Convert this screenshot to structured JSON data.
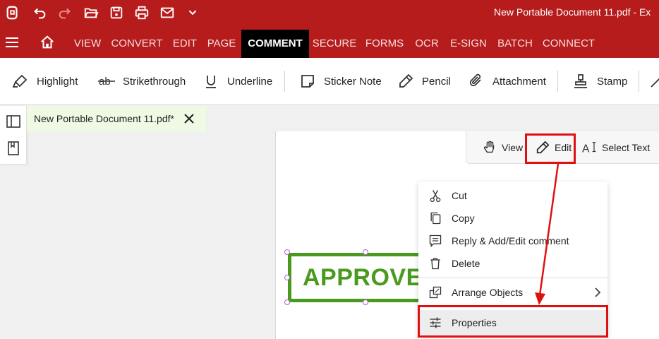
{
  "titlebar": {
    "document_title": "New Portable Document 11.pdf   -   Ex",
    "quick_access": [
      "app-logo-icon",
      "undo-icon",
      "redo-icon",
      "open-folder-icon",
      "save-icon",
      "print-icon",
      "email-icon",
      "chevron-down-icon"
    ]
  },
  "menu": {
    "tabs": [
      "VIEW",
      "CONVERT",
      "EDIT",
      "PAGE",
      "COMMENT",
      "SECURE",
      "FORMS",
      "OCR",
      "E-SIGN",
      "BATCH",
      "CONNECT"
    ],
    "active_tab": "COMMENT"
  },
  "ribbon": {
    "highlight": "Highlight",
    "strikethrough": "Strikethrough",
    "underline": "Underline",
    "sticker_note": "Sticker Note",
    "pencil": "Pencil",
    "attachment": "Attachment",
    "stamp": "Stamp"
  },
  "doc_tab": {
    "name": "New Portable Document 11.pdf*"
  },
  "modes": {
    "view": "View",
    "edit": "Edit",
    "select_text": "Select Text"
  },
  "stamp": {
    "text": "APPROVED"
  },
  "context_menu": {
    "cut": "Cut",
    "copy": "Copy",
    "reply": "Reply & Add/Edit comment",
    "delete": "Delete",
    "arrange": "Arrange Objects",
    "properties": "Properties"
  },
  "colors": {
    "brand": "#b71c1c",
    "active_tab": "#000000",
    "stamp_green": "#4a9a1c",
    "annotation_red": "#e01010"
  }
}
